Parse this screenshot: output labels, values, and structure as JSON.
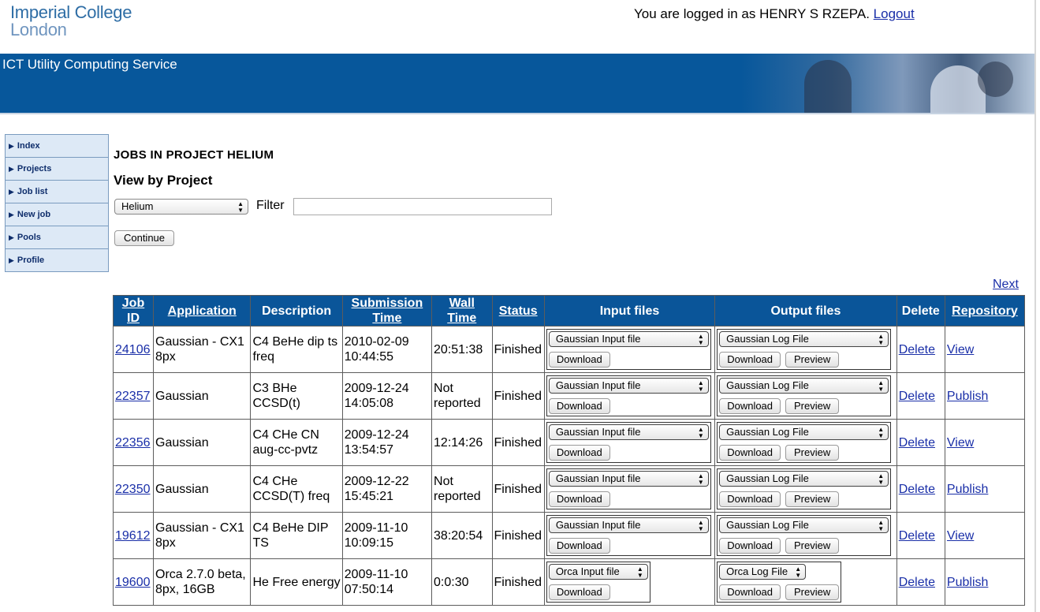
{
  "header": {
    "logo_line1": "Imperial College",
    "logo_line2": "London",
    "login_text": "You are logged in as HENRY S RZEPA.",
    "logout_label": "Logout",
    "banner_title": "ICT Utility Computing Service"
  },
  "nav": {
    "items": [
      "Index",
      "Projects",
      "Job list",
      "New job",
      "Pools",
      "Profile"
    ]
  },
  "main": {
    "title": "JOBS IN PROJECT HELIUM",
    "subtitle": "View by Project",
    "project_select": "Helium",
    "filter_label": "Filter",
    "filter_value": "",
    "continue_label": "Continue",
    "next_label": "Next"
  },
  "table": {
    "headers": {
      "job_id": "Job ID",
      "application": "Application",
      "description": "Description",
      "submission_time": "Submission Time",
      "wall_time": "Wall Time",
      "status": "Status",
      "input_files": "Input files",
      "output_files": "Output files",
      "delete": "Delete",
      "repository": "Repository"
    },
    "download_label": "Download",
    "preview_label": "Preview",
    "delete_label": "Delete",
    "rows": [
      {
        "id": "24106",
        "app": "Gaussian - CX1 8px",
        "desc": "C4 BeHe dip ts freq",
        "submitted": "2010-02-09 10:44:55",
        "wall": "20:51:38",
        "status": "Finished",
        "input": "Gaussian Input file",
        "output": "Gaussian Log File",
        "repo": "View"
      },
      {
        "id": "22357",
        "app": "Gaussian",
        "desc": "C3 BHe CCSD(t)",
        "submitted": "2009-12-24 14:05:08",
        "wall": "Not reported",
        "status": "Finished",
        "input": "Gaussian Input file",
        "output": "Gaussian Log File",
        "repo": "Publish"
      },
      {
        "id": "22356",
        "app": "Gaussian",
        "desc": "C4 CHe CN aug-cc-pvtz",
        "submitted": "2009-12-24 13:54:57",
        "wall": "12:14:26",
        "status": "Finished",
        "input": "Gaussian Input file",
        "output": "Gaussian Log File",
        "repo": "View"
      },
      {
        "id": "22350",
        "app": "Gaussian",
        "desc": "C4 CHe CCSD(T) freq",
        "submitted": "2009-12-22 15:45:21",
        "wall": "Not reported",
        "status": "Finished",
        "input": "Gaussian Input file",
        "output": "Gaussian Log File",
        "repo": "Publish"
      },
      {
        "id": "19612",
        "app": "Gaussian - CX1 8px",
        "desc": "C4 BeHe DIP TS",
        "submitted": "2009-11-10 10:09:15",
        "wall": "38:20:54",
        "status": "Finished",
        "input": "Gaussian Input file",
        "output": "Gaussian Log File",
        "repo": "View"
      },
      {
        "id": "19600",
        "app": "Orca 2.7.0 beta, 8px, 16GB",
        "desc": "He Free energy",
        "submitted": "2009-11-10 07:50:14",
        "wall": "0:0:30",
        "status": "Finished",
        "input": "Orca Input file",
        "output": "Orca Log File",
        "repo": "Publish"
      }
    ]
  }
}
